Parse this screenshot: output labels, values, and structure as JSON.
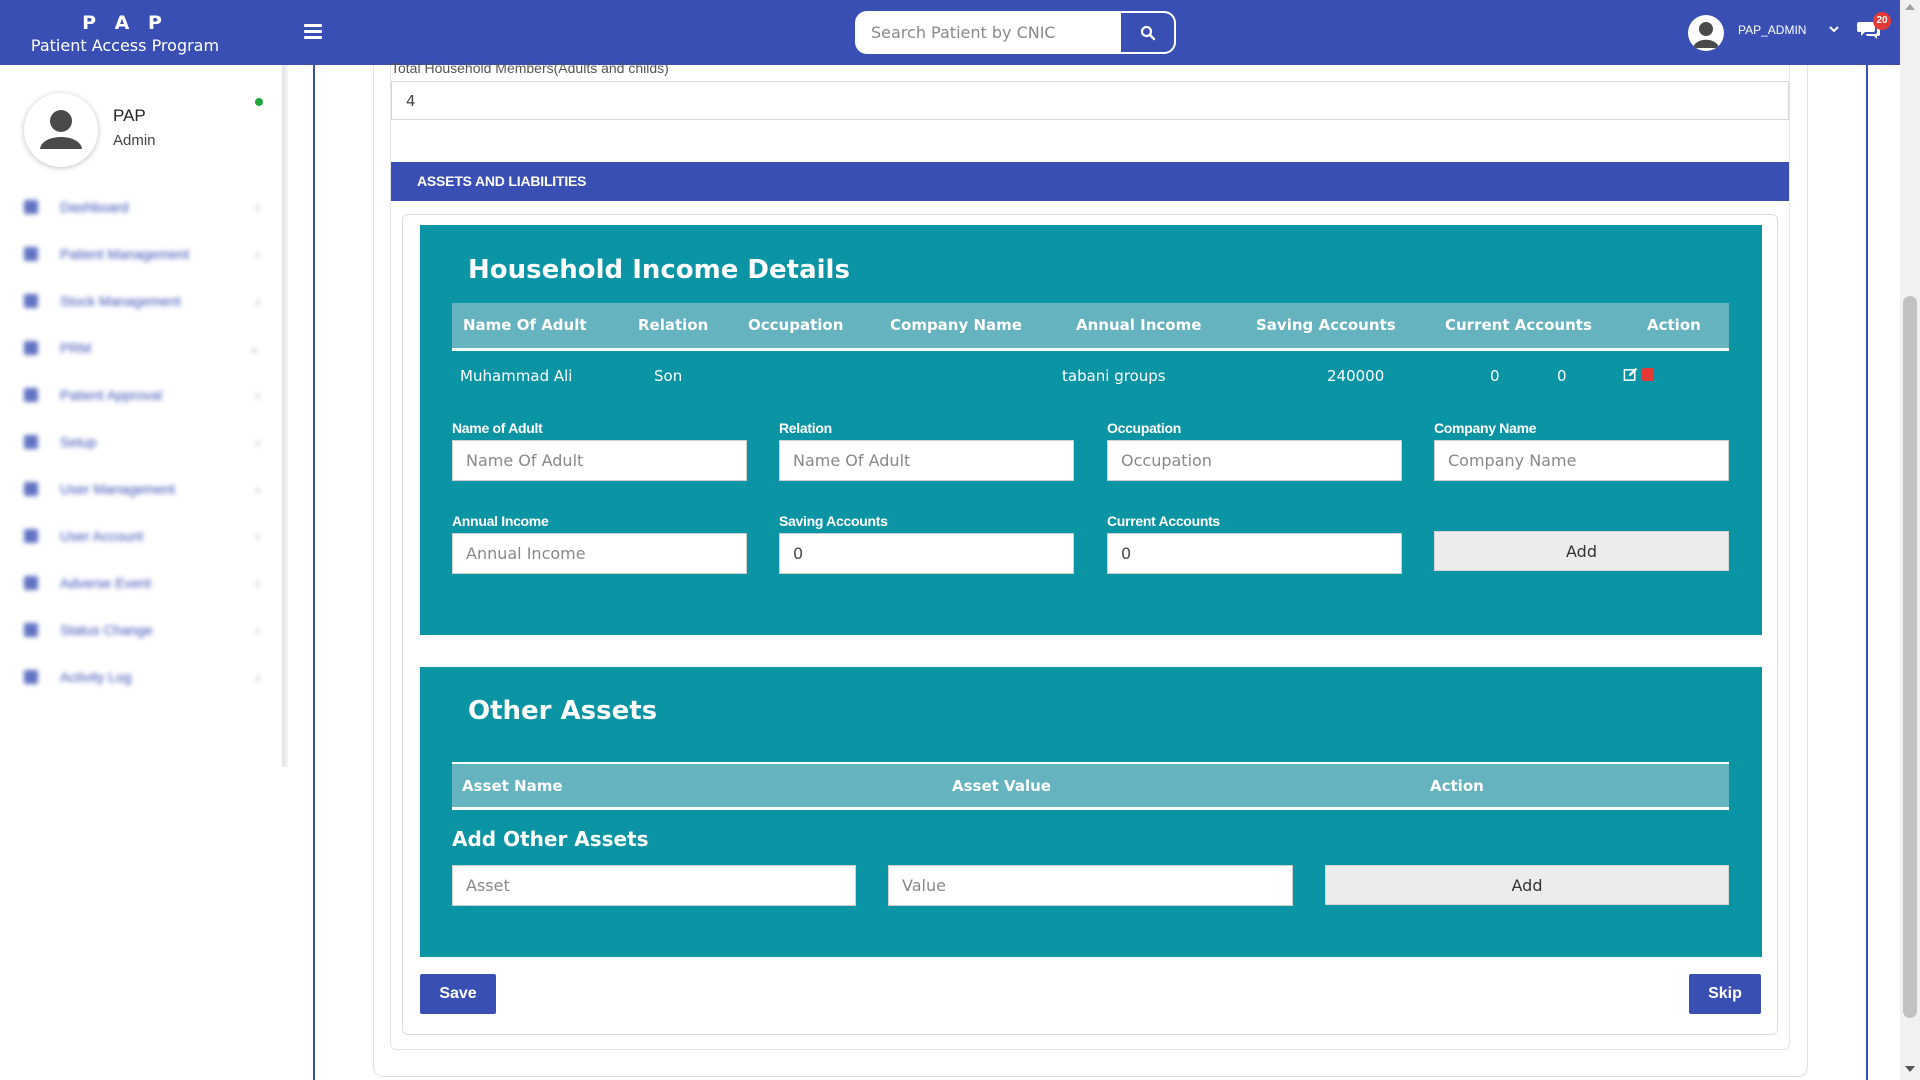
{
  "header": {
    "brand_title": "P A P",
    "brand_subtitle": "Patient Access Program",
    "search_placeholder": "Search Patient by CNIC",
    "user_name": "PAP_ADMIN",
    "notification_count": "20"
  },
  "sidebar": {
    "profile_name": "PAP",
    "profile_role": "Admin",
    "items": [
      {
        "label": "Dashboard"
      },
      {
        "label": "Patient Management"
      },
      {
        "label": "Stock Management"
      },
      {
        "label": "PRM"
      },
      {
        "label": "Patient Approval"
      },
      {
        "label": "Setup"
      },
      {
        "label": "User Management"
      },
      {
        "label": "User Account"
      },
      {
        "label": "Adverse Event"
      },
      {
        "label": "Status Change"
      },
      {
        "label": "Activity Log"
      }
    ]
  },
  "form": {
    "members_label": "Total Household Members(Adults and childs)",
    "members_value": "4",
    "section_title": "ASSETS AND LIABILITIES"
  },
  "income": {
    "title": "Household Income Details",
    "columns": [
      "Name Of Adult",
      "Relation",
      "Occupation",
      "Company Name",
      "Annual Income",
      "Saving Accounts",
      "Current Accounts",
      "Action"
    ],
    "rows": [
      {
        "name": "Muhammad Ali",
        "relation": "Son",
        "occupation": "",
        "company": "tabani groups",
        "annual_income": "240000",
        "saving": "0",
        "current": "0"
      }
    ],
    "fields": {
      "name_label": "Name of Adult",
      "name_placeholder": "Name Of Adult",
      "relation_label": "Relation",
      "relation_placeholder": "Name Of Adult",
      "occupation_label": "Occupation",
      "occupation_placeholder": "Occupation",
      "company_label": "Company Name",
      "company_placeholder": "Company Name",
      "annual_label": "Annual Income",
      "annual_placeholder": "Annual Income",
      "saving_label": "Saving Accounts",
      "saving_value": "0",
      "current_label": "Current Accounts",
      "current_value": "0",
      "add_label": "Add"
    }
  },
  "assets": {
    "title": "Other Assets",
    "columns": [
      "Asset Name",
      "Asset Value",
      "Action"
    ],
    "subheading": "Add Other Assets",
    "asset_placeholder": "Asset",
    "value_placeholder": "Value",
    "add_label": "Add"
  },
  "actions": {
    "save_label": "Save",
    "skip_label": "Skip"
  },
  "colors": {
    "primary": "#3a4fb4",
    "teal": "#0a94a4",
    "table_header": "#66b3c0",
    "online": "#22a63b",
    "danger": "#e53935"
  }
}
